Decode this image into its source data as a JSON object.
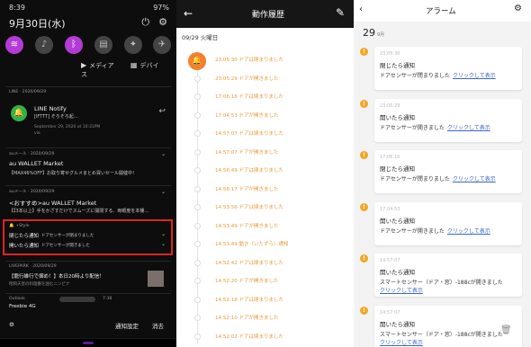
{
  "panel1": {
    "status_time": "8:39",
    "status_right": "97%",
    "date": "9月30日(水)",
    "media_label": "メディア",
    "devices_label": "デバイス",
    "notifications": [
      {
        "app": "LINE",
        "time": "2020/09/29",
        "title": "LINE Notify",
        "line1": "[IFTTT] そろそろ起…",
        "line2": "September 29, 2020 at 10:31PM",
        "line3": "via"
      },
      {
        "app": "auメール",
        "time": "2020/09/29",
        "title": "au WALLET Market",
        "line1": "【MAX46%OFF】お取り寄せグルメまとめ買いセール開催中！"
      },
      {
        "app": "auメール",
        "time": "2020/09/29",
        "title": "<おすすめ>au WALLET Market",
        "line1": "【【3本以上】手をかざすだけでスムーズに開閉する、両眼度を本棚…"
      },
      {
        "app": "+Style",
        "line1_title": "閉じたら通知",
        "line1_body": "ドアセンサーが閉まりました",
        "line2_title": "開いたら通知",
        "line2_body": "ドアセンサーが開きました"
      },
      {
        "app": "LIVEPARK",
        "time": "2020/09/29",
        "title": "【龍行雄行で掴め！】本日20時より配信！",
        "line1": "昭和天皇の料理番を囲むニンピナ"
      },
      {
        "app": "Outlook",
        "time": "7:38",
        "title": "Freebie 4G"
      }
    ],
    "notif_settings": "通知設定",
    "clear_all": "消去"
  },
  "panel2": {
    "title": "動作履歴",
    "date_header": "09/29 火曜日",
    "rows": [
      "23:05:30 ドアは閉まりました",
      "23:05:29 ドアが開きました",
      "17:06:16 ドアは閉まりました",
      "17:04:53 ドアが開きました",
      "14:57:07 ドアは閉まりました",
      "14:57:07 ドアが開きました",
      "14:56:49 ドアは閉まりました",
      "14:56:17 ドアが開きました",
      "14:53:56 ドアは閉まりました",
      "14:53:49 ドアが開きました",
      "14:53:49 動き（いたずら）通知",
      "14:52:42 ドアは閉まりました",
      "14:52:20 ドアが開きました",
      "14:52:18 ドアは閉まりました",
      "14:52:10 ドアが開きました",
      "14:52:02 ドアは閉まりました"
    ]
  },
  "panel3": {
    "title": "アラーム",
    "day": "29",
    "month": "9月",
    "link_text": "クリックして表示",
    "cards": [
      {
        "time": "23:05:30",
        "title": "閉じたら通知",
        "body": "ドアセンサーが閉まりました"
      },
      {
        "time": "23:05:29",
        "title": "開いたら通知",
        "body": "ドアセンサーが開きました"
      },
      {
        "time": "17:06:16",
        "title": "閉じたら通知",
        "body": "ドアセンサーが閉まりました"
      },
      {
        "time": "17:04:53",
        "title": "開いたら通知",
        "body": "ドアセンサーが開きました"
      },
      {
        "time": "14:57:07",
        "title": "開いたら通知",
        "body": "スマートセンサー（ドア・窓）-188cが開きました"
      },
      {
        "time": "14:57:07",
        "title": "開いたら通知",
        "body": "スマートセンサー（ドア・窓）-188cが開きました"
      }
    ]
  },
  "colors": {
    "accent_purple": "#b43bd6",
    "timeline_orange": "#e89a3c",
    "highlight_red": "#e02424",
    "warn_amber": "#f5a623",
    "link_blue": "#3a68c8"
  }
}
